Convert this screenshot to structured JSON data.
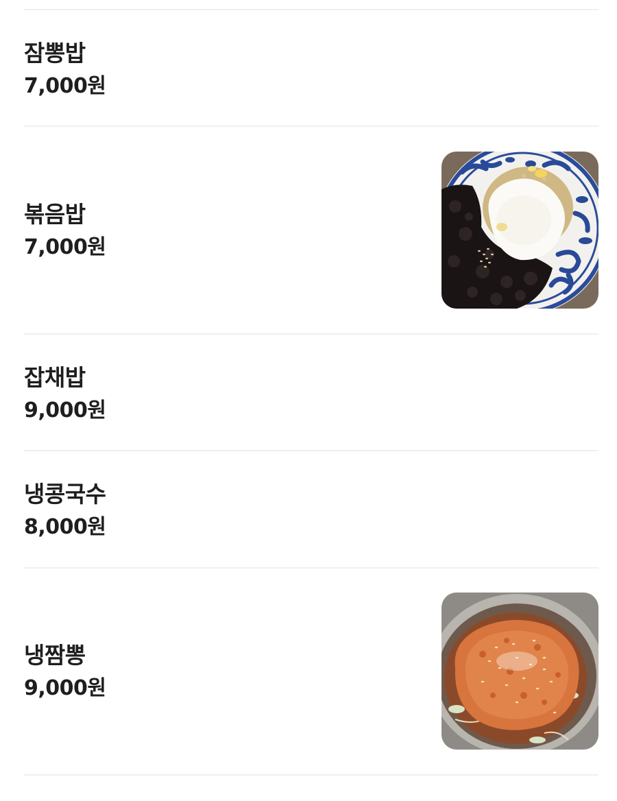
{
  "menu": {
    "items": [
      {
        "name": "잠뽕밥",
        "price": "7,000원",
        "has_image": false
      },
      {
        "name": "볶음밥",
        "price": "7,000원",
        "has_image": true,
        "image": "fried-rice-with-black-bean-sauce-and-egg"
      },
      {
        "name": "잡채밥",
        "price": "9,000원",
        "has_image": false
      },
      {
        "name": "냉콩국수",
        "price": "8,000원",
        "has_image": false
      },
      {
        "name": "냉짬뽕",
        "price": "9,000원",
        "has_image": true,
        "image": "cold-jjamppong-with-fried-pork-cutlet"
      }
    ]
  }
}
